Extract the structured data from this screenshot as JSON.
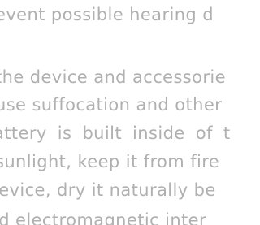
{
  "document": {
    "lines": [
      "event possible hearing d",
      "the device and accessorie",
      "use suffocation and other",
      "attery is built inside of t",
      "sunlight, keep it from fire",
      "levice, dry it naturally be",
      "id electromagnetic inter"
    ]
  }
}
